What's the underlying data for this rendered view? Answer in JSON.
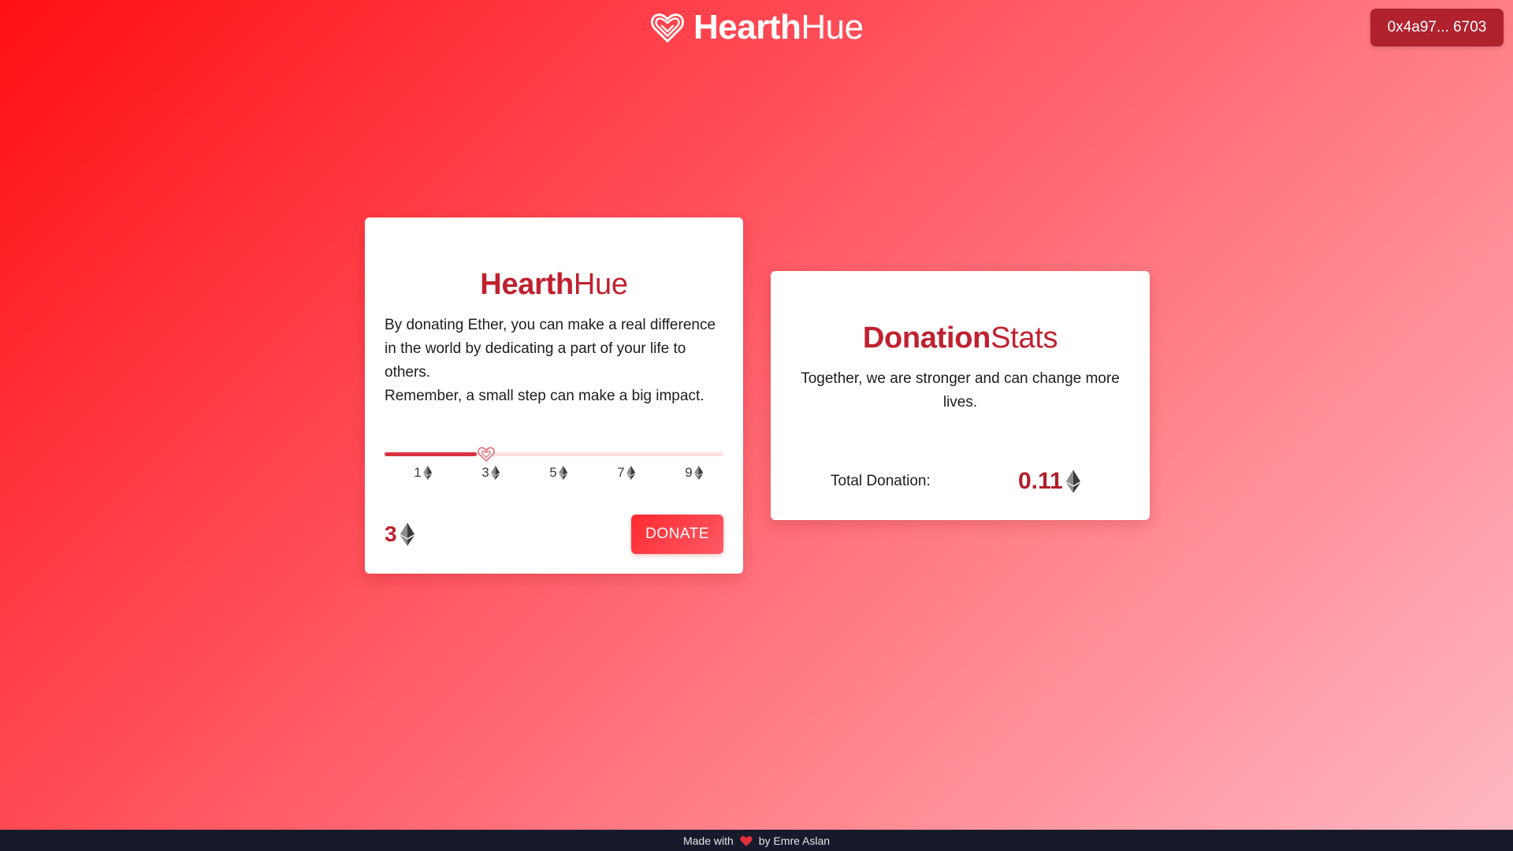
{
  "header": {
    "brand_bold": "Hearth",
    "brand_light": "Hue",
    "logo_icon": "heart-logo-icon",
    "wallet_label": "0x4a97... 6703"
  },
  "donate_card": {
    "title_bold": "Hearth",
    "title_light": "Hue",
    "paragraph_1": "By donating Ether, you can make a real difference in the world by dedicating a part of your life to others.",
    "paragraph_2": "Remember, a small step can make a big impact.",
    "slider": {
      "min": 1,
      "max": 9,
      "value": 3,
      "ticks": [
        "1",
        "3",
        "5",
        "7",
        "9"
      ],
      "tick_icon": "ethereum-icon",
      "thumb_icon": "heart-thumb-icon"
    },
    "amount": "3",
    "amount_icon": "ethereum-icon",
    "donate_button": "DONATE"
  },
  "stats_card": {
    "title_bold": "Donation",
    "title_light": "Stats",
    "description": "Together, we are stronger and can change more lives.",
    "total_label": "Total Donation:",
    "total_value": "0.11",
    "total_icon": "ethereum-icon"
  },
  "footer": {
    "made_with": "Made with",
    "by": "by Emre Aslan",
    "heart_icon": "heart-icon"
  },
  "colors": {
    "accent": "#c0212f",
    "wallet_button": "#b0222e",
    "footer_bg": "#161a2a",
    "slider_fill": "#d8323c",
    "slider_track": "#fde0e2"
  }
}
